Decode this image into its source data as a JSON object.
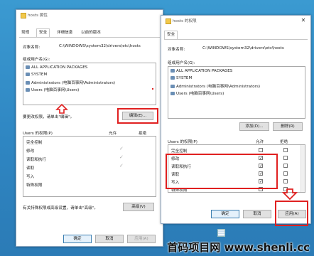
{
  "left_window": {
    "title": "hosts 属性",
    "tabs": [
      "常规",
      "安全",
      "详细信息",
      "以前的版本"
    ],
    "object_label": "对象名称:",
    "object_path": "C:\\WINDOWS\\system32\\drivers\\etc\\hosts",
    "group_label": "组或用户名(G):",
    "users": [
      "ALL APPLICATION PACKAGES",
      "SYSTEM",
      "Administrators (电脑百事网\\Administrators)",
      "Users (电脑百事网\\Users)"
    ],
    "edit_hint": "要更改权限，请单击\"编辑\"。",
    "edit_button": "编辑(E)...",
    "perm_label": "Users 的权限(P)",
    "allow_col": "允许",
    "deny_col": "拒绝",
    "permissions": [
      "完全控制",
      "修改",
      "读取和执行",
      "读取",
      "写入",
      "特殊权限"
    ],
    "permissions_allowed": [
      false,
      false,
      true,
      true,
      false,
      false
    ],
    "advanced_hint": "有关特殊权限或高级设置，请单击\"高级\"。",
    "advanced_button": "高级(V)",
    "ok_button": "确定",
    "cancel_button": "取消",
    "apply_button": "应用(A)"
  },
  "right_window": {
    "title": "hosts 的权限",
    "tab": "安全",
    "object_label": "对象名称:",
    "object_path": "C:\\WINDOWS\\system32\\drivers\\etc\\hosts",
    "group_label": "组或用户名(G):",
    "users": [
      "ALL APPLICATION PACKAGES",
      "SYSTEM",
      "Administrators (电脑百事网\\Administrators)",
      "Users (电脑百事网\\Users)"
    ],
    "add_button": "添加(D)...",
    "remove_button": "删除(R)",
    "perm_label": "Users 的权限(P)",
    "allow_col": "允许",
    "deny_col": "拒绝",
    "permissions": [
      "完全控制",
      "修改",
      "读取和执行",
      "读取",
      "写入",
      "特殊权限"
    ],
    "permissions_allowed": [
      false,
      true,
      true,
      true,
      true,
      false
    ],
    "ok_button": "确定",
    "cancel_button": "取消",
    "apply_button": "应用(A)"
  },
  "watermark": "首码项目网 www.shenli.cc",
  "annotation_color": "#e02020"
}
